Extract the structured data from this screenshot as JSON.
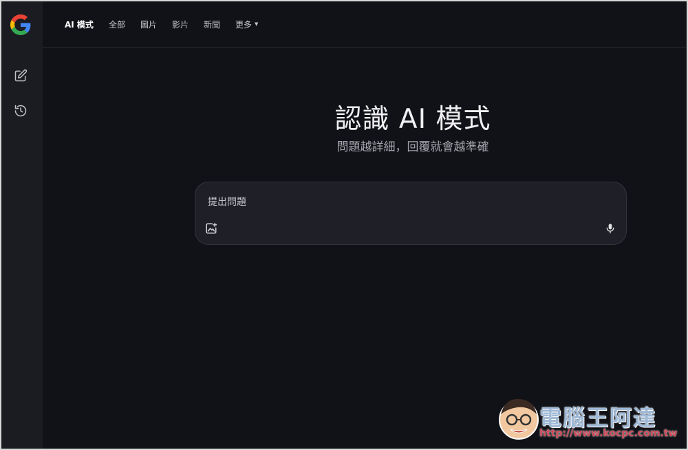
{
  "topbar": {
    "tabs": [
      {
        "label": "AI 模式",
        "active": true
      },
      {
        "label": "全部"
      },
      {
        "label": "圖片"
      },
      {
        "label": "影片"
      },
      {
        "label": "新聞"
      },
      {
        "label": "更多",
        "has_dropdown": true
      }
    ]
  },
  "sidebar": {
    "logo_icon": "google-g-icon",
    "items": [
      {
        "icon": "edit-icon"
      },
      {
        "icon": "history-icon"
      }
    ]
  },
  "hero": {
    "title": "認識 AI 模式",
    "subtitle": "問題越詳細，回覆就會越準確"
  },
  "search": {
    "placeholder": "提出問題",
    "value": "",
    "image_icon": "add-image-icon",
    "mic_icon": "microphone-icon"
  },
  "watermark": {
    "brand": "電腦王阿達",
    "url": "http://www.kocpc.com.tw"
  },
  "colors": {
    "background": "#111217",
    "sidebar": "#1b1c22",
    "searchbox": "#1f2027"
  }
}
